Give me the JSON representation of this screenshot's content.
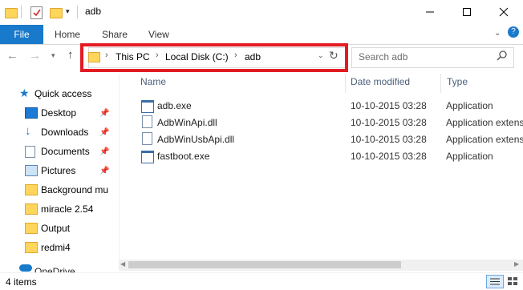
{
  "window": {
    "title": "adb"
  },
  "ribbon": {
    "file": "File",
    "home": "Home",
    "share": "Share",
    "view": "View"
  },
  "address": {
    "crumbs": [
      "This PC",
      "Local Disk (C:)",
      "adb"
    ]
  },
  "search": {
    "placeholder": "Search adb"
  },
  "nav": [
    {
      "label": "Quick access",
      "icon": "star-icon",
      "pinned": false
    },
    {
      "label": "Desktop",
      "icon": "desktop-icon",
      "pinned": true
    },
    {
      "label": "Downloads",
      "icon": "download-icon",
      "pinned": true
    },
    {
      "label": "Documents",
      "icon": "documents-icon",
      "pinned": true
    },
    {
      "label": "Pictures",
      "icon": "pictures-icon",
      "pinned": true
    },
    {
      "label": "Background mu",
      "icon": "folder-icon",
      "pinned": false
    },
    {
      "label": "miracle 2.54",
      "icon": "folder-icon",
      "pinned": false
    },
    {
      "label": "Output",
      "icon": "folder-icon",
      "pinned": false
    },
    {
      "label": "redmi4",
      "icon": "folder-icon",
      "pinned": false
    },
    {
      "label": "OneDrive",
      "icon": "cloud-icon",
      "pinned": false
    }
  ],
  "columns": {
    "name": "Name",
    "date": "Date modified",
    "type": "Type"
  },
  "files": [
    {
      "name": "adb.exe",
      "date": "10-10-2015 03:28",
      "type": "Application",
      "icon": "application-icon"
    },
    {
      "name": "AdbWinApi.dll",
      "date": "10-10-2015 03:28",
      "type": "Application extens",
      "icon": "dll-icon"
    },
    {
      "name": "AdbWinUsbApi.dll",
      "date": "10-10-2015 03:28",
      "type": "Application extens",
      "icon": "dll-icon"
    },
    {
      "name": "fastboot.exe",
      "date": "10-10-2015 03:28",
      "type": "Application",
      "icon": "application-icon"
    }
  ],
  "status": {
    "count": "4 items"
  },
  "colors": {
    "file_tab": "#1979ca",
    "highlight": "#e31b23",
    "folder": "#ffd65c"
  }
}
